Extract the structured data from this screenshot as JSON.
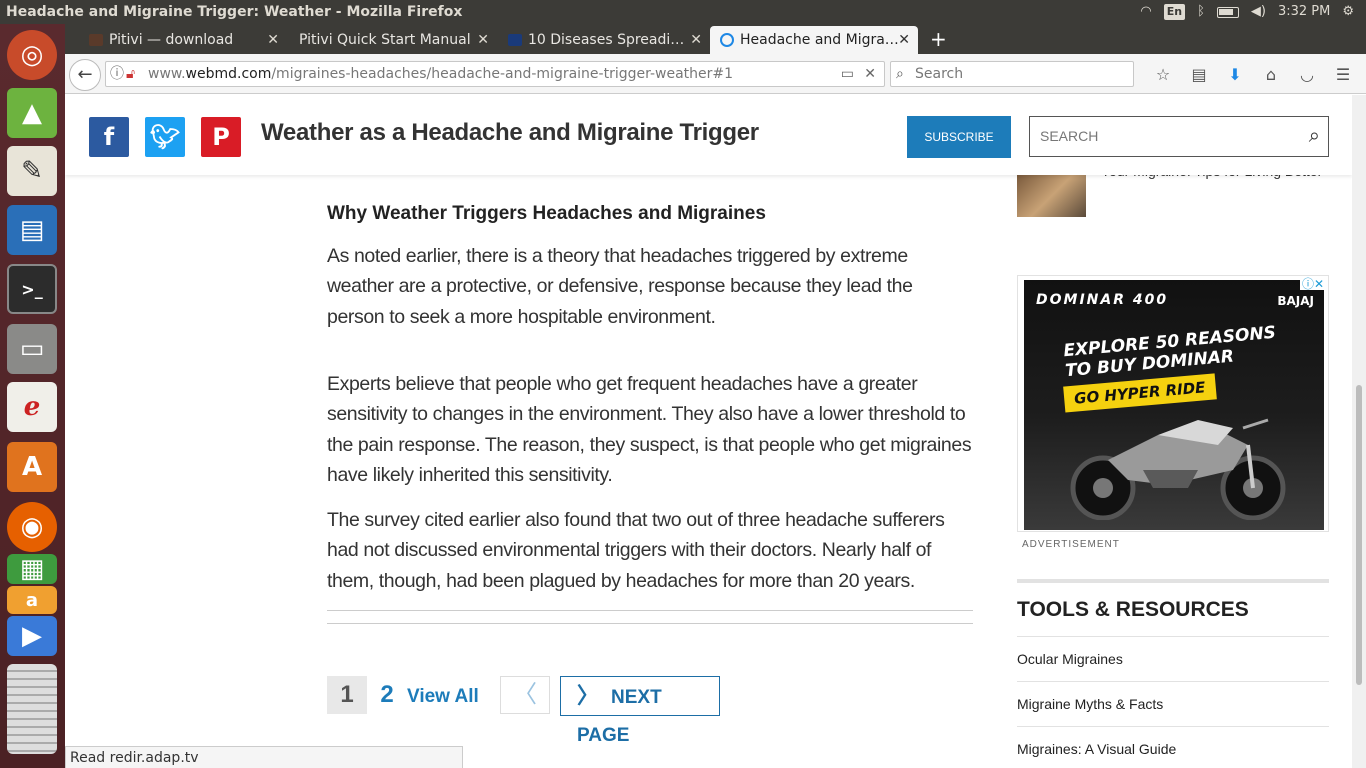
{
  "system": {
    "window_title": "Headache and Migraine Trigger: Weather - Mozilla Firefox",
    "keyboard": "En",
    "clock": "3:32 PM"
  },
  "launcher": {
    "icons": [
      "ubuntu-logo-icon",
      "android-studio-icon",
      "text-editor-icon",
      "libreoffice-writer-icon",
      "terminal-icon",
      "files-icon",
      "document-viewer-icon",
      "software-center-icon",
      "firefox-icon",
      "libreoffice-calc-icon",
      "amazon-icon",
      "vlc-icon",
      "trash-icon"
    ]
  },
  "tabs": [
    {
      "label": "Pitivi — download",
      "favicon_color": "#5a3a2a"
    },
    {
      "label": "Pitivi Quick Start Manual",
      "favicon_color": "#3c3b37"
    },
    {
      "label": "10 Diseases Spreadi…",
      "favicon_color": "#1a3a7a"
    },
    {
      "label": "Headache and Migra…",
      "favicon_color": "#1e88e5"
    }
  ],
  "address": {
    "prefix": "www.",
    "domain": "webmd.com",
    "path": "/migraines-headaches/headache-and-migraine-trigger-weather#1"
  },
  "search": {
    "placeholder": "Search"
  },
  "header": {
    "title": "Weather as a Headache and Migraine Trigger",
    "subscribe": "SUBSCRIBE",
    "search_placeholder": "SEARCH"
  },
  "article": {
    "heading": "Why Weather Triggers Headaches and Migraines",
    "p1": [
      "As noted earlier, there is a theory that headaches triggered by extreme",
      "weather are a protective, or defensive, response because they lead the",
      "person to seek a more hospitable environment."
    ],
    "p2": [
      "Experts believe that people who get frequent headaches have a greater",
      "sensitivity to changes in the environment. They also have a lower threshold to",
      "the pain response. The reason, they suspect, is that people who get migraines",
      "have likely inherited this sensitivity."
    ],
    "p3": [
      "The survey cited earlier also found that two out of three headache sufferers",
      "had not discussed environmental triggers with their doctors. Nearly half of",
      "them, though, had been plagued by headaches for more than 20 years."
    ]
  },
  "pagination": {
    "page1": "1",
    "page2": "2",
    "view_all": "View All",
    "next": "NEXT PAGE"
  },
  "sidebar": {
    "promo_text": "Your Migraine: Tips for Living Better",
    "ad": {
      "brand": "DOMINAR 400",
      "headline_1": "EXPLORE 50 REASONS",
      "headline_2": "TO BUY DOMINAR",
      "cta": "GO HYPER RIDE",
      "maker": "BAJAJ"
    },
    "ad_label": "ADVERTISEMENT",
    "tools_heading": "TOOLS & RESOURCES",
    "tools": [
      "Ocular Migraines",
      "Migraine Myths & Facts",
      "Migraines: A Visual Guide"
    ]
  },
  "status": {
    "text": "Read redir.adap.tv"
  }
}
